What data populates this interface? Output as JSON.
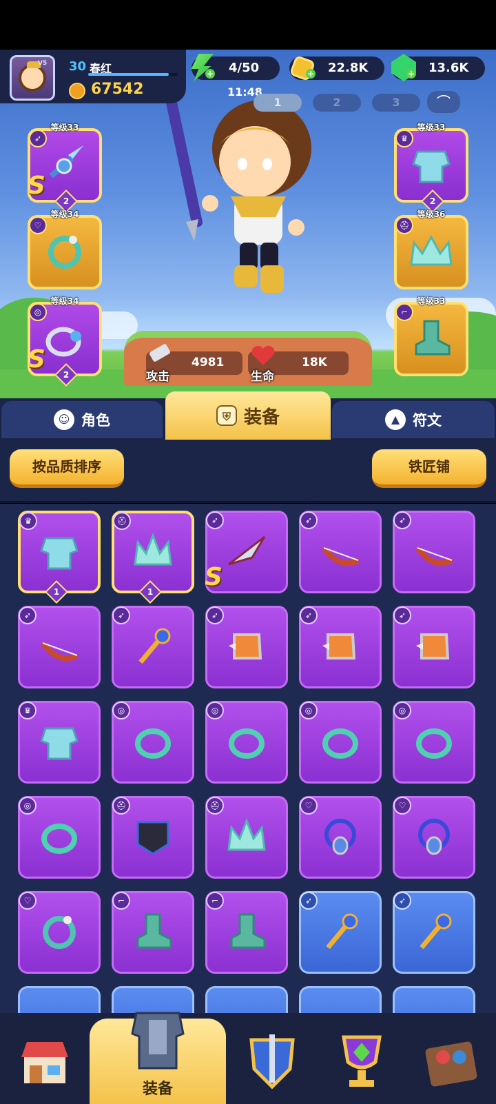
{
  "player": {
    "level": "30",
    "name": "春红",
    "vip": "V5",
    "power": "67542",
    "xp_progress": 0.9
  },
  "resources": {
    "energy": "4/50",
    "gold": "22.8K",
    "gems": "13.6K"
  },
  "clock": "11:48",
  "loadouts": [
    "1",
    "2",
    "3"
  ],
  "equipped": {
    "left": [
      {
        "level": "等级33",
        "type_icon": "bow-icon",
        "item": "spear-icon",
        "rarity": "S",
        "count": "2"
      },
      {
        "level": "等级34",
        "type_icon": "necklace-icon",
        "item": "bracelet-icon",
        "rarity": "",
        "count": ""
      },
      {
        "level": "等级34",
        "type_icon": "ring-icon",
        "item": "ring-icon",
        "rarity": "S",
        "count": "2"
      }
    ],
    "right": [
      {
        "level": "等级33",
        "type_icon": "armor-icon",
        "item": "armor-icon",
        "count": "2"
      },
      {
        "level": "等级36",
        "type_icon": "helmet-icon",
        "item": "crown-icon",
        "count": ""
      },
      {
        "level": "等级33",
        "type_icon": "boot-icon",
        "item": "boot-icon",
        "count": ""
      }
    ]
  },
  "stats": {
    "attack_label": "攻击",
    "attack_value": "4981",
    "hp_label": "生命",
    "hp_value": "18K"
  },
  "tabs": {
    "character": "角色",
    "equipment": "装备",
    "runes": "符文"
  },
  "toolbar": {
    "sort_label": "按品质排序",
    "smith_label": "铁匠铺"
  },
  "inventory": [
    {
      "type": "armor-icon",
      "item": "armor-icon",
      "frame": "selected",
      "count": "1"
    },
    {
      "type": "helmet-icon",
      "item": "crown-icon",
      "frame": "selected",
      "count": "1"
    },
    {
      "type": "bow-icon",
      "item": "dart-icon",
      "frame": "purple",
      "rarity": "S"
    },
    {
      "type": "bow-icon",
      "item": "bow-icon",
      "frame": "purple"
    },
    {
      "type": "bow-icon",
      "item": "bow-icon",
      "frame": "purple"
    },
    {
      "type": "bow-icon",
      "item": "bow-icon",
      "frame": "purple"
    },
    {
      "type": "bow-icon",
      "item": "staff-icon",
      "frame": "purple"
    },
    {
      "type": "bow-icon",
      "item": "claw-icon",
      "frame": "purple"
    },
    {
      "type": "bow-icon",
      "item": "claw-icon",
      "frame": "purple"
    },
    {
      "type": "bow-icon",
      "item": "claw-icon",
      "frame": "purple"
    },
    {
      "type": "armor-icon",
      "item": "armor-icon",
      "frame": "purple"
    },
    {
      "type": "ring-icon",
      "item": "ring-icon",
      "frame": "purple"
    },
    {
      "type": "ring-icon",
      "item": "ring-icon",
      "frame": "purple"
    },
    {
      "type": "ring-icon",
      "item": "ring-icon",
      "frame": "purple"
    },
    {
      "type": "ring-icon",
      "item": "ring-icon",
      "frame": "purple"
    },
    {
      "type": "ring-icon",
      "item": "ring-icon",
      "frame": "purple"
    },
    {
      "type": "helmet-icon",
      "item": "mask-icon",
      "frame": "purple"
    },
    {
      "type": "helmet-icon",
      "item": "crown-icon",
      "frame": "purple"
    },
    {
      "type": "necklace-icon",
      "item": "amulet-icon",
      "frame": "purple"
    },
    {
      "type": "necklace-icon",
      "item": "amulet-icon",
      "frame": "purple"
    },
    {
      "type": "necklace-icon",
      "item": "bracelet-icon",
      "frame": "purple"
    },
    {
      "type": "boot-icon",
      "item": "boot-icon",
      "frame": "purple"
    },
    {
      "type": "boot-icon",
      "item": "boot-icon",
      "frame": "purple"
    },
    {
      "type": "bow-icon",
      "item": "staff-icon",
      "frame": "blue"
    },
    {
      "type": "bow-icon",
      "item": "staff-icon",
      "frame": "blue"
    }
  ],
  "nav": {
    "equipment_label": "装备"
  },
  "colors": {
    "accent": "#f4c24a",
    "purple_frame": "#b04ae8",
    "blue_frame": "#5a8cf0",
    "panel": "#1f2a52"
  }
}
